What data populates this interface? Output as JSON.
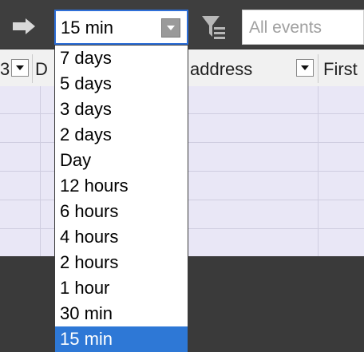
{
  "toolbar": {
    "arrow_icon": "arrow-right-icon",
    "period_combo": {
      "value": "15 min",
      "arrow_icon": "chevron-down-icon"
    },
    "filter_icon": "filter-icon",
    "search": {
      "placeholder": "All events"
    }
  },
  "table": {
    "headers": [
      {
        "text": "3",
        "has_dropdown": true
      },
      {
        "text": "D",
        "has_dropdown": false
      },
      {
        "text": "address",
        "has_dropdown": true
      },
      {
        "text": "First",
        "has_dropdown": false
      }
    ]
  },
  "dropdown": {
    "options": [
      "7 days",
      "5 days",
      "3 days",
      "2 days",
      "Day",
      "12 hours",
      "6 hours",
      "4 hours",
      "2 hours",
      "1 hour",
      "30 min",
      "15 min"
    ],
    "selected": "15 min"
  },
  "colors": {
    "toolbar_bg": "#3e3e3e",
    "grid_bg": "#e9e7f6",
    "selected_bg": "#2e78d6",
    "combo_border": "#2e6fd8"
  }
}
